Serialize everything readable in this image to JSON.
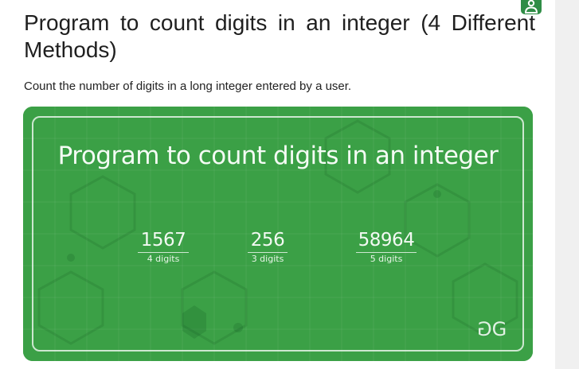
{
  "article": {
    "title": "Program to count digits in an integer (4 Different Methods)",
    "description": "Count the number of digits in a long integer entered by a user."
  },
  "banner": {
    "title": "Program to count digits in an integer",
    "examples": [
      {
        "number": "1567",
        "digits": "4 digits"
      },
      {
        "number": "256",
        "digits": "3 digits"
      },
      {
        "number": "58964",
        "digits": "5 digits"
      }
    ],
    "logo_text": "G",
    "logo_name": "gfg-logo",
    "background_color": "#3ba046"
  },
  "icons": {
    "account": "user-account-icon"
  },
  "colors": {
    "brand_green": "#2f8d46",
    "sidebar_gray": "#f0f0f0"
  }
}
